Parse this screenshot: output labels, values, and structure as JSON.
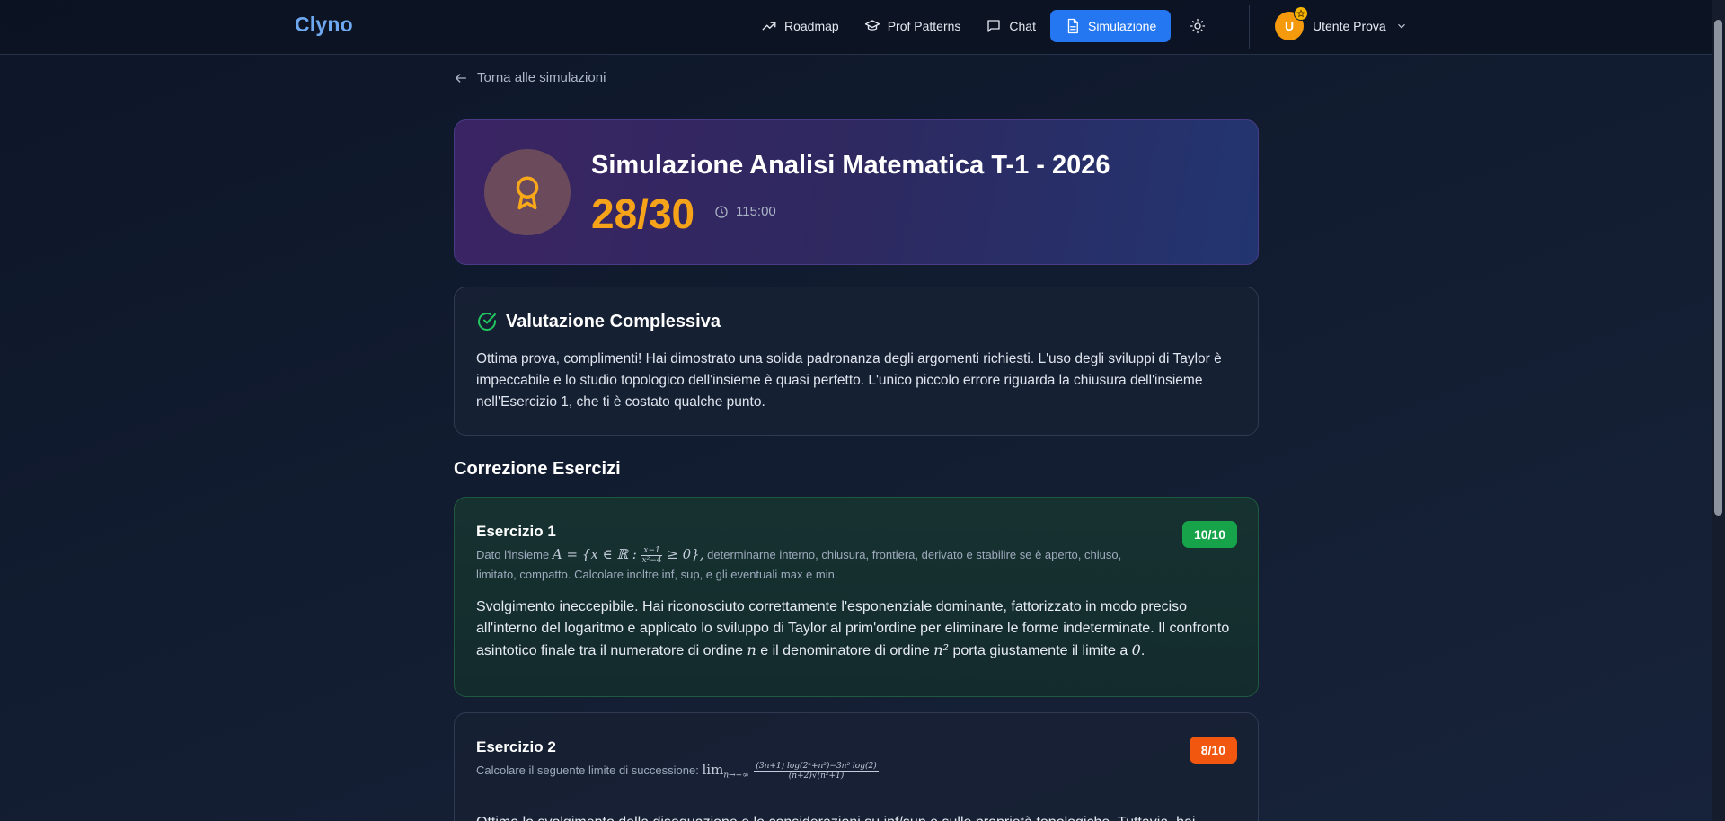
{
  "brand": "Clyno",
  "nav": {
    "roadmap": "Roadmap",
    "prof_patterns": "Prof Patterns",
    "chat": "Chat",
    "simulazione": "Simulazione"
  },
  "user": {
    "initial": "U",
    "name": "Utente Prova"
  },
  "back_link": "Torna alle simulazioni",
  "hero": {
    "title": "Simulazione Analisi Matematica T-1 - 2026",
    "score": "28/30",
    "time": "115:00"
  },
  "summary": {
    "title": "Valutazione Complessiva",
    "text": "Ottima prova, complimenti! Hai dimostrato una solida padronanza degli argomenti richiesti. L'uso degli sviluppi di Taylor è impeccabile e lo studio topologico dell'insieme è quasi perfetto. L'unico piccolo errore riguarda la chiusura dell'insieme nell'Esercizio 1, che ti è costato qualche punto."
  },
  "section_title": "Correzione Esercizi",
  "exercises": [
    {
      "title": "Esercizio 1",
      "score": "10/10",
      "prompt_before": "Dato l'insieme",
      "prompt_math": "A = {x ∈ ℝ :",
      "prompt_frac_num": "x−1",
      "prompt_frac_den": "x²−4",
      "prompt_math_after": "≥ 0},",
      "prompt_after": "determinarne interno, chiusura, frontiera, derivato e stabilire se è aperto, chiuso, limitato, compatto. Calcolare inoltre inf, sup, e gli eventuali max e min.",
      "body_1": "Svolgimento ineccepibile. Hai riconosciuto correttamente l'esponenziale dominante, fattorizzato in modo preciso all'interno del logaritmo e applicato lo sviluppo di Taylor al prim'ordine per eliminare le forme indeterminate. Il confronto asintotico finale tra il numeratore di ordine",
      "body_m1": "n",
      "body_2": "e il denominatore di ordine",
      "body_m2": "n²",
      "body_3": "porta giustamente il limite a",
      "body_m3": "0",
      "body_4": "."
    },
    {
      "title": "Esercizio 2",
      "score": "8/10",
      "prompt_before": "Calcolare il seguente limite di successione:",
      "prompt_math": "lim",
      "prompt_sub": "n→+∞",
      "prompt_frac_num": "(3n+1) log(2ⁿ+n²)−3n² log(2)",
      "prompt_frac_den": "(n+2)√(n²+1)",
      "body_1": "Ottimo lo svolgimento della disequazione e le considerazioni su inf/sup e sulle proprietà topologiche. Tuttavia, hai"
    }
  ],
  "colors": {
    "accent": "#2477f0",
    "score": "#f6a31a",
    "success": "#16a34a",
    "warning": "#f2570f"
  }
}
